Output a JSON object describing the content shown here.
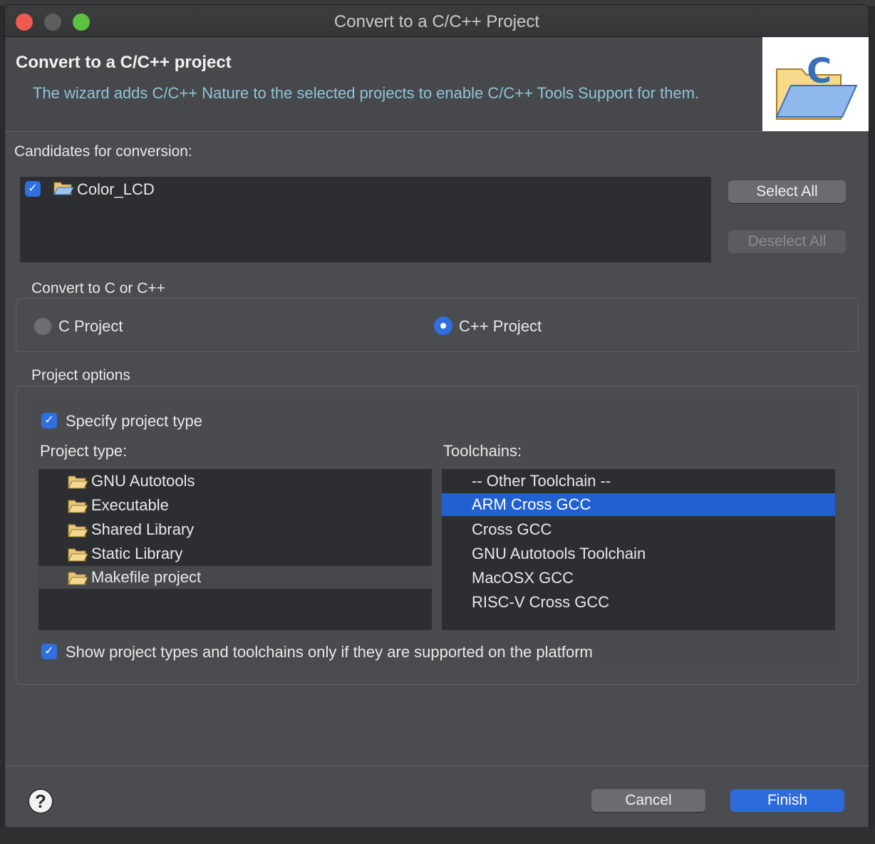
{
  "window": {
    "title": "Convert to a C/C++ Project"
  },
  "header": {
    "title": "Convert to a C/C++ project",
    "description": "The wizard adds C/C++ Nature to the selected projects to enable C/C++ Tools Support for them.",
    "image_icon": "c-folder-wizard-icon"
  },
  "candidates": {
    "label": "Candidates for conversion:",
    "items": [
      {
        "name": "Color_LCD",
        "checked": true
      }
    ],
    "select_all": "Select All",
    "deselect_all": "Deselect All"
  },
  "language": {
    "label": "Convert to C or C++",
    "options": [
      {
        "label": "C Project",
        "selected": false
      },
      {
        "label": "C++ Project",
        "selected": true
      }
    ]
  },
  "project_options": {
    "label": "Project options",
    "specify_type": {
      "label": "Specify project type",
      "checked": true
    },
    "project_type_label": "Project type:",
    "project_types": [
      "GNU Autotools",
      "Executable",
      "Shared Library",
      "Static Library",
      "Makefile project"
    ],
    "selected_project_type": "Makefile project",
    "toolchains_label": "Toolchains:",
    "toolchains": [
      "-- Other Toolchain --",
      "ARM Cross GCC",
      "Cross GCC",
      "GNU Autotools Toolchain",
      "MacOSX GCC",
      "RISC-V Cross GCC"
    ],
    "selected_toolchain": "ARM Cross GCC",
    "show_supported": {
      "label": "Show project types and toolchains only if they are supported on the platform",
      "checked": true
    }
  },
  "footer": {
    "help_symbol": "?",
    "cancel": "Cancel",
    "finish": "Finish"
  },
  "colors": {
    "accent": "#2d6bdc",
    "selection": "#2160d0",
    "description_text": "#8fc4d6"
  }
}
